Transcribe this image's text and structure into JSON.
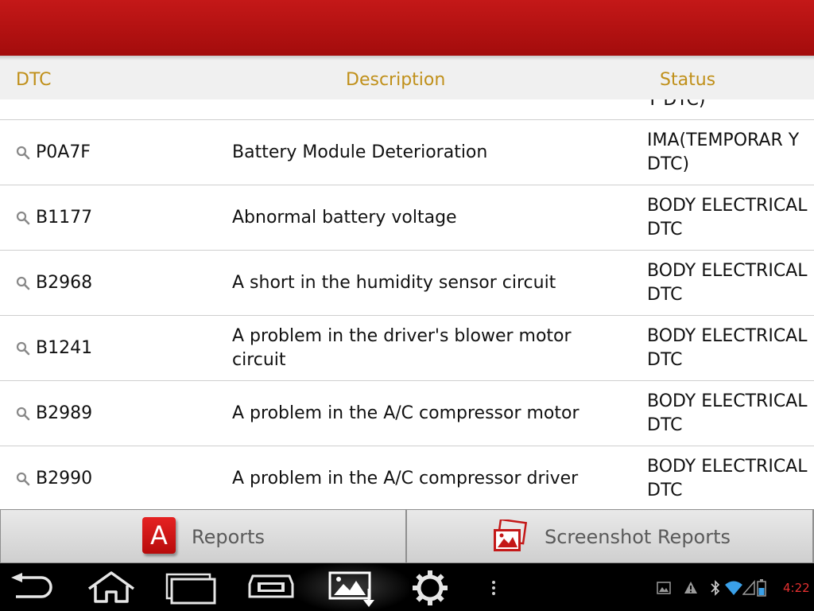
{
  "header": {
    "dtc": "DTC",
    "description": "Description",
    "status": "Status"
  },
  "rows": [
    {
      "code": "",
      "description": "",
      "status": "Y DTC)"
    },
    {
      "code": "P0A7F",
      "description": "Battery Module Deterioration",
      "status": "IMA(TEMPORAR Y DTC)"
    },
    {
      "code": "B1177",
      "description": "Abnormal battery voltage",
      "status": "BODY ELECTRICAL DTC"
    },
    {
      "code": "B2968",
      "description": "A short in the humidity sensor circuit",
      "status": "BODY ELECTRICAL DTC"
    },
    {
      "code": "B1241",
      "description": "A problem in the driver's blower motor circuit",
      "status": "BODY ELECTRICAL DTC"
    },
    {
      "code": "B2989",
      "description": "A problem in the A/C compressor motor",
      "status": "BODY ELECTRICAL DTC"
    },
    {
      "code": "B2990",
      "description": "A problem in the A/C compressor driver",
      "status": "BODY ELECTRICAL DTC"
    }
  ],
  "bottom": {
    "reports_label": "Reports",
    "reports_icon_letter": "A",
    "screenshot_reports_label": "Screenshot Reports"
  },
  "status_bar": {
    "time": "4:22"
  },
  "colors": {
    "topbar": "#b31212",
    "header_text": "#c0901a",
    "time": "#e53030"
  }
}
